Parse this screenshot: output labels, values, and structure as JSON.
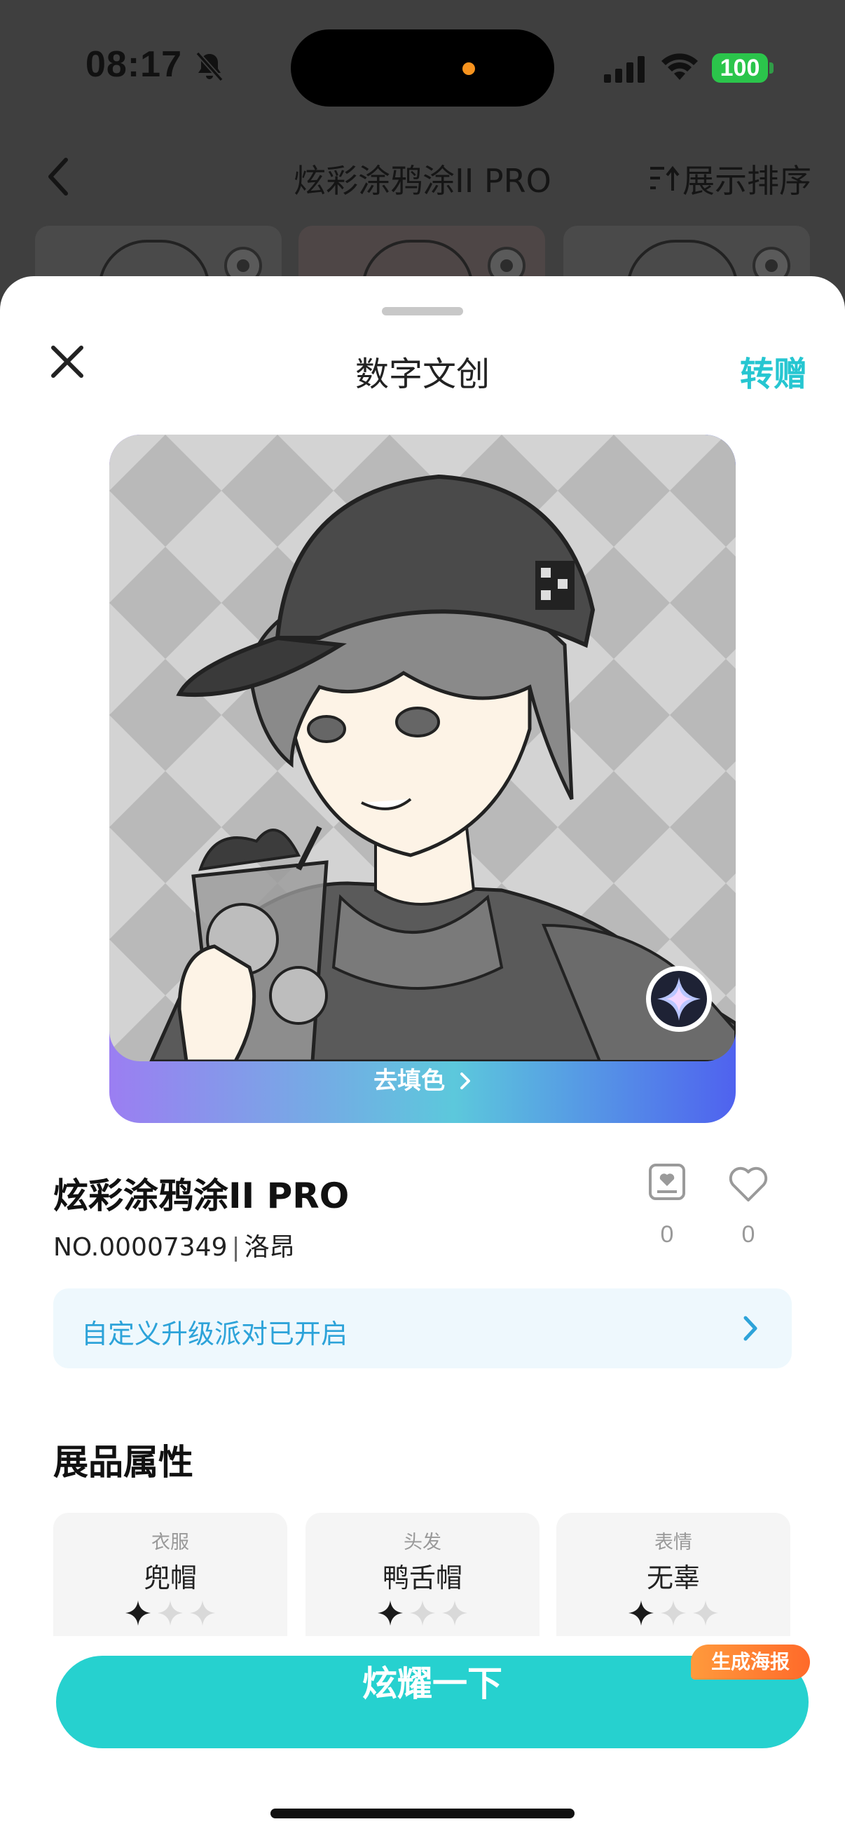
{
  "status_bar": {
    "time": "08:17",
    "battery": "100",
    "icons": [
      "bell-slash-icon",
      "signal-icon",
      "wifi-icon",
      "battery-icon"
    ]
  },
  "background_page": {
    "title": "炫彩涂鸦涂II PRO",
    "sort_label": "展示排序",
    "icons": [
      "back-chevron-icon",
      "sort-icon",
      "eye-icon"
    ]
  },
  "sheet": {
    "title": "数字文创",
    "gift_label": "转赠",
    "icons": [
      "close-icon",
      "chevron-right-icon",
      "star-badge-icon",
      "collect-icon",
      "heart-icon"
    ]
  },
  "artwork": {
    "coloring_label": "去填色"
  },
  "item": {
    "name": "炫彩涂鸦涂II PRO",
    "number": "NO.00007349",
    "owner": "洛昂",
    "collect_count": "0",
    "like_count": "0"
  },
  "party_banner": {
    "text": "自定义升级派对已开启"
  },
  "attributes": {
    "title": "展品属性",
    "items": [
      {
        "label": "衣服",
        "value": "兜帽",
        "stars": 1,
        "max_stars": 3
      },
      {
        "label": "头发",
        "value": "鸭舌帽",
        "stars": 1,
        "max_stars": 3
      },
      {
        "label": "表情",
        "value": "无辜",
        "stars": 1,
        "max_stars": 3
      }
    ]
  },
  "cta": {
    "label": "炫耀一下",
    "tag": "生成海报"
  },
  "colors": {
    "accent": "#26D1CF",
    "link": "#26C6D1",
    "banner_text": "#2DA3D9",
    "tag": "#FF7A2F"
  }
}
